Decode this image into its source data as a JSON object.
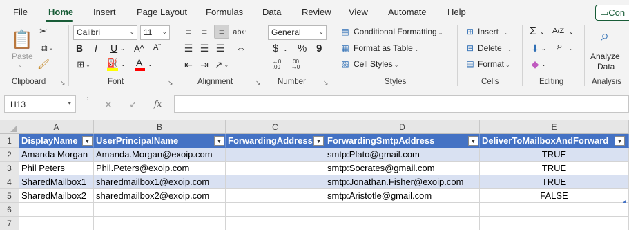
{
  "menu": {
    "tabs": [
      {
        "label": "File"
      },
      {
        "label": "Home",
        "active": true
      },
      {
        "label": "Insert"
      },
      {
        "label": "Page Layout"
      },
      {
        "label": "Formulas"
      },
      {
        "label": "Data"
      },
      {
        "label": "Review"
      },
      {
        "label": "View"
      },
      {
        "label": "Automate"
      },
      {
        "label": "Help"
      }
    ],
    "comments_label": "Con"
  },
  "ribbon": {
    "clipboard": {
      "paste_label": "Paste",
      "group_label": "Clipboard"
    },
    "font": {
      "font_name": "Calibri",
      "font_size": "11",
      "bold": "B",
      "italic": "I",
      "underline": "U",
      "grow": "A^",
      "shrink": "Aˇ",
      "group_label": "Font",
      "highlight_color": "#ffff00",
      "font_color": "#ff0000"
    },
    "alignment": {
      "group_label": "Alignment"
    },
    "number": {
      "format": "General",
      "currency": "$",
      "percent": "%",
      "comma": "9",
      "group_label": "Number"
    },
    "styles": {
      "conditional_formatting": "Conditional Formatting",
      "format_as_table": "Format as Table",
      "cell_styles": "Cell Styles",
      "group_label": "Styles"
    },
    "cells": {
      "insert": "Insert",
      "delete": "Delete",
      "format": "Format",
      "group_label": "Cells"
    },
    "editing": {
      "autosum": "Σ",
      "sort": "A/Z",
      "find": "⌕",
      "group_label": "Editing"
    },
    "analysis": {
      "analyze_line1": "Analyze",
      "analyze_line2": "Data",
      "group_label": "Analysis"
    }
  },
  "formula_bar": {
    "name_box": "H13",
    "cancel": "✕",
    "enter": "✓",
    "fx": "fx",
    "formula": ""
  },
  "sheet": {
    "columns": [
      "A",
      "B",
      "C",
      "D",
      "E"
    ],
    "rows": [
      "1",
      "2",
      "3",
      "4",
      "5",
      "6",
      "7"
    ],
    "header": [
      "DisplayName",
      "UserPrincipalName",
      "ForwardingAddress",
      "ForwardingSmtpAddress",
      "DeliverToMailboxAndForward"
    ],
    "data": [
      [
        "Amanda Morgan",
        "Amanda.Morgan@exoip.com",
        "",
        "smtp:Plato@gmail.com",
        "TRUE"
      ],
      [
        "Phil Peters",
        "Phil.Peters@exoip.com",
        "",
        "smtp:Socrates@gmail.com",
        "TRUE"
      ],
      [
        "SharedMailbox1",
        "sharedmailbox1@exoip.com",
        "",
        "smtp:Jonathan.Fisher@exoip.com",
        "TRUE"
      ],
      [
        "SharedMailbox2",
        "sharedmailbox2@exoip.com",
        "",
        "smtp:Aristotle@gmail.com",
        "FALSE"
      ]
    ],
    "table_header_color": "#4472c4",
    "band_color": "#d9e1f2"
  }
}
